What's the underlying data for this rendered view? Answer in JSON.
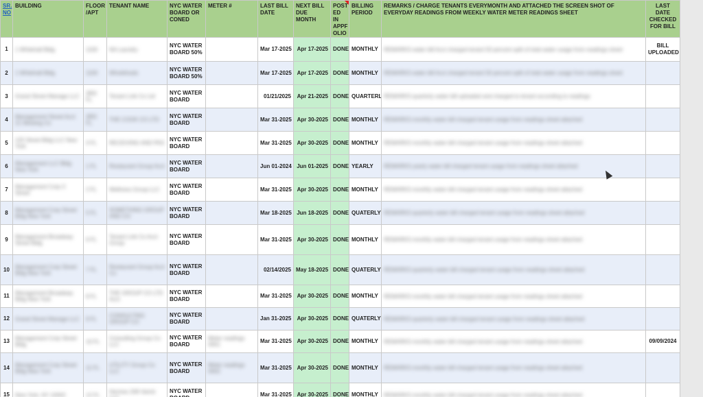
{
  "headers": {
    "sr": "SR. NO",
    "building": "BUILDING",
    "floor": "FLOOR /APT",
    "tenant": "TENANT NAME",
    "board": "NYC WATER BOARD  OR CONED",
    "meter": "METER #",
    "last_bill": "LAST BILL DATE",
    "next_bill": "NEXT BILL DUE MONTH",
    "posted": "POST ED IN APPF OLIO",
    "period": "BILLING PERIOD",
    "remarks": "REMARKS / CHARGE TENANTS EVERYMONTH AND ATTACHED THE SCREEN SHOT OF EVERYDAY READINGS FROM WEEKLY WATER METER READINGS SHEET",
    "last_checked": "LAST DATE CHECKED FOR BILL"
  },
  "rows": [
    {
      "sr": "1",
      "building_blur": "1 Whitehall Bldg",
      "floor_blur": "1100",
      "tenant_blur": "NA Laundry",
      "tenant_prefix": "N",
      "board": "NYC WATER BOARD 50%",
      "meter_blur": "",
      "last": "Mar 17-2025",
      "next": "Apr 17-2025",
      "posted": "DONE",
      "period": "MONTHLY",
      "remarks_blur": "REMARKS water bill Acct charged tenant 50 percent split of total water usage from readings sheet",
      "last_checked": "BILL UPLOADED"
    },
    {
      "sr": "2",
      "building_blur": "1 Whitehall Bldg",
      "floor_blur": "1100",
      "tenant_blur": "Wholefoods",
      "tenant_prefix": "",
      "board": "NYC WATER BOARD 50%",
      "meter_blur": "",
      "last": "Mar 17-2025",
      "next": "Apr 17-2025",
      "posted": "DONE",
      "period": "MONTHLY",
      "remarks_blur": "REMARKS water bill Acct charged tenant 50 percent split of total water usage from readings sheet",
      "last_checked": ""
    },
    {
      "sr": "3",
      "building_blur": "Grand Street Manage LLC",
      "floor_blur": "3RD FL",
      "tenant_blur": "Tenant Link Co Ltd",
      "tenant_prefix": "",
      "board": "NYC WATER BOARD",
      "meter_blur": "",
      "last": "01/21/2025",
      "next": "Apr 21-2025",
      "posted": "DONE",
      "period": "QUARTERLY",
      "remarks_blur": "REMARKS quarterly water bill uploaded and charged to tenant according to readings",
      "last_checked": ""
    },
    {
      "sr": "4",
      "building_blur": "Management Street Acct 21 Westing Co",
      "floor_blur": "3RD FL",
      "tenant_blur": "THE COOK CO LTD",
      "tenant_prefix": "",
      "board": "NYC WATER BOARD",
      "meter_blur": "",
      "last": "Mar 31-2025",
      "next": "Apr 30-2025",
      "posted": "DONE",
      "period": "MONTHLY",
      "remarks_blur": "REMARKS monthly water bill charged tenant usage from readings sheet attached",
      "last_checked": ""
    },
    {
      "sr": "5",
      "building_blur": "125 Street Bldg LLC New York",
      "floor_blur": "4 FL",
      "tenant_blur": "RECEIVING AND PAS",
      "tenant_prefix": "",
      "board": "NYC WATER BOARD",
      "meter_blur": "",
      "last": "Mar 31-2025",
      "next": "Apr 30-2025",
      "posted": "DONE",
      "period": "MONTHLY",
      "remarks_blur": "REMARKS monthly water bill charged tenant usage from readings sheet attached",
      "last_checked": ""
    },
    {
      "sr": "6",
      "building_blur": "Management LLC Bldg New York",
      "floor_blur": "1 FL",
      "tenant_blur": "Restaurant Group Acct",
      "tenant_prefix": "",
      "board": "NYC WATER BOARD",
      "meter_blur": "",
      "last": "Jun 01-2024",
      "next": "Jun 01-2025",
      "posted": "DONE",
      "period": "YEARLY",
      "remarks_blur": "REMARKS yearly water bill charged tenant usage from readings sheet attached",
      "last_checked": ""
    },
    {
      "sr": "7",
      "building_blur": "Management Corp 3 Street",
      "floor_blur": "2 FL",
      "tenant_blur": "Wellness Group LLC",
      "tenant_prefix": "",
      "board": "NYC WATER BOARD",
      "meter_blur": "",
      "last": "Mar 31-2025",
      "next": "Apr 30-2025",
      "posted": "DONE",
      "period": "MONTHLY",
      "remarks_blur": "REMARKS monthly water bill charged tenant usage from readings sheet attached",
      "last_checked": ""
    },
    {
      "sr": "8",
      "building_blur": "Management Corp Street Bldg New York",
      "floor_blur": "5 FL",
      "tenant_blur": "SOMETHING GROUP AND CO",
      "tenant_prefix": "",
      "board": "NYC WATER BOARD",
      "meter_blur": "",
      "last": "Mar 18-2025",
      "next": "Jun 18-2025",
      "posted": "DONE",
      "period": "QUATERLY",
      "remarks_blur": "REMARKS quarterly water bill charged tenant usage from readings sheet attached",
      "last_checked": ""
    },
    {
      "sr": "9",
      "building_blur": "Management Broadway Street Bldg",
      "floor_blur": "6 FL",
      "tenant_blur": "Tenant Link Co Acct Group",
      "tenant_prefix": "",
      "board": "NYC WATER BOARD",
      "meter_blur": "",
      "last": "Mar 31-2025",
      "next": "Apr 30-2025",
      "posted": "DONE",
      "period": "MONTHLY",
      "remarks_blur": "REMARKS monthly water bill charged tenant usage from readings sheet attached",
      "last_checked": ""
    },
    {
      "sr": "10",
      "building_blur": "Management Corp Street Bldg New York",
      "floor_blur": "7 FL",
      "tenant_blur": "Restaurant Group Acct Co",
      "tenant_prefix": "",
      "board": "NYC WATER BOARD",
      "meter_blur": "",
      "last": "02/14/2025",
      "next": "May 18-2025",
      "posted": "DONE",
      "period": "QUATERLY",
      "remarks_blur": "REMARKS quarterly water bill charged tenant usage from readings sheet attached",
      "last_checked": ""
    },
    {
      "sr": "11",
      "building_blur": "Management Broadway Bldg New York",
      "floor_blur": "8 FL",
      "tenant_blur": "THE GROUP CO LTD Acct",
      "tenant_prefix": "",
      "board": "NYC WATER BOARD",
      "meter_blur": "",
      "last": "Mar 31-2025",
      "next": "Apr 30-2025",
      "posted": "DONE",
      "period": "MONTHLY",
      "remarks_blur": "REMARKS monthly water bill charged tenant usage from readings sheet attached",
      "last_checked": ""
    },
    {
      "sr": "12",
      "building_blur": "Grand Street Manage LLC",
      "floor_blur": "9 FL",
      "tenant_blur": "CONSULTING GROUP CO",
      "tenant_prefix": "",
      "board": "NYC WATER BOARD",
      "meter_blur": "",
      "last": "Jan 31-2025",
      "next": "Apr 30-2025",
      "posted": "DONE",
      "period": "QUATERLY",
      "remarks_blur": "REMARKS quarterly water bill charged tenant usage from readings sheet attached",
      "last_checked": ""
    },
    {
      "sr": "13",
      "building_blur": "Management Corp Street Bldg",
      "floor_blur": "10 FL",
      "tenant_blur": "Consulting Group Co LLC",
      "tenant_prefix": "",
      "board": "NYC WATER BOARD",
      "meter_blur": "Meter readings 0001",
      "last": "Mar 31-2025",
      "next": "Apr 30-2025",
      "posted": "DONE",
      "period": "MONTHLY",
      "remarks_blur": "REMARKS monthly water bill charged tenant usage from readings sheet attached",
      "last_checked": "09/09/2024"
    },
    {
      "sr": "14",
      "building_blur": "Management Corp Street Bldg New York",
      "floor_blur": "11 FL",
      "tenant_blur": "UTILITY Group Co LLC",
      "tenant_prefix": "",
      "board": "NYC WATER BOARD",
      "meter_blur": "Meter readings 0002",
      "last": "Mar 31-2025",
      "next": "Apr 30-2025",
      "posted": "DONE",
      "period": "MONTHLY",
      "remarks_blur": "REMARKS monthly water bill charged tenant usage from readings sheet attached",
      "last_checked": ""
    },
    {
      "sr": "15",
      "building_blur": "New York, NY 10002",
      "floor_blur": "12 FL",
      "tenant_blur": "Hermes 208 Varick LLC",
      "tenant_prefix": "",
      "board": "NYC WATER BOARD",
      "meter_blur": "",
      "last": "Mar 31-2025",
      "next": "Apr 30-2025",
      "posted": "DONE",
      "period": "MONTHLY",
      "remarks_blur": "REMARKS monthly water bill charged tenant usage from readings sheet attached",
      "last_checked": ""
    }
  ]
}
